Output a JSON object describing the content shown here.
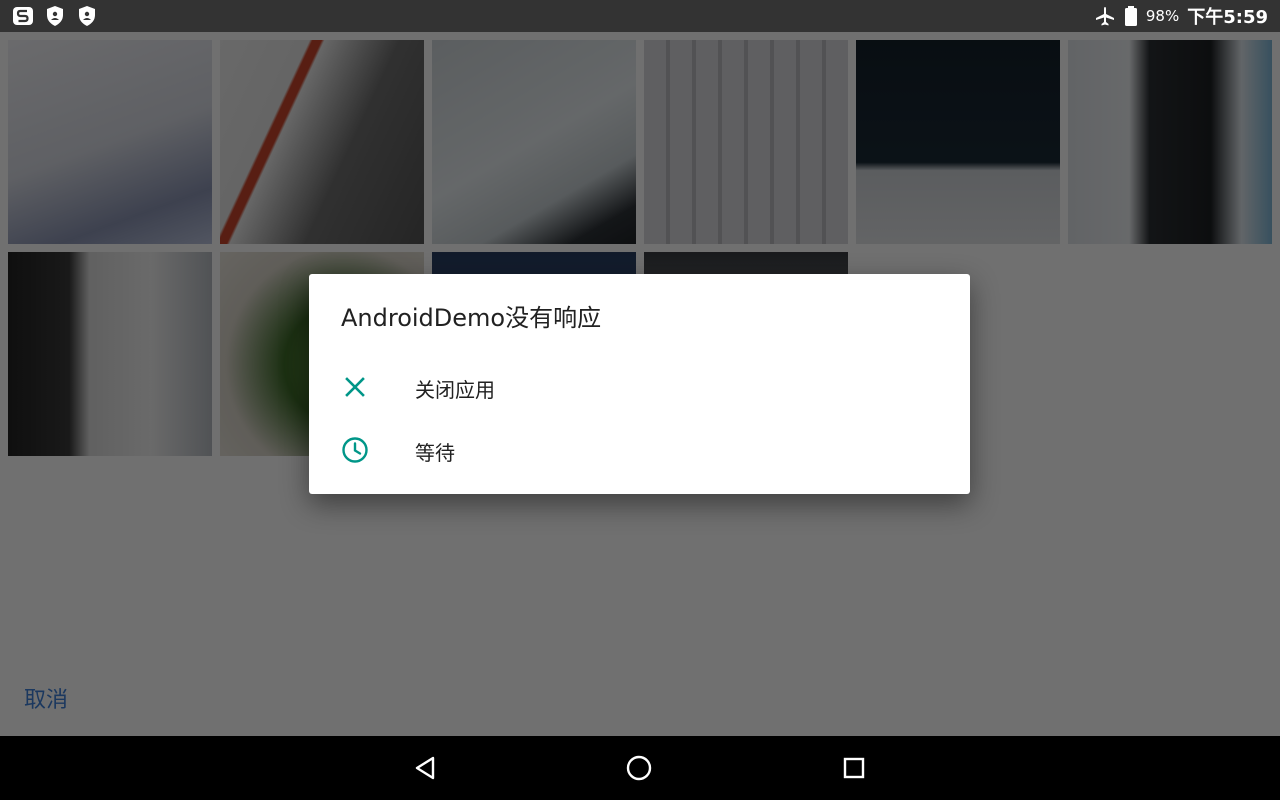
{
  "status_bar": {
    "left_icons": [
      "app-s-icon",
      "shield-icon",
      "shield-icon"
    ],
    "right_icons": [
      "airplane-mode-icon",
      "battery-icon"
    ],
    "battery_percent": "98%",
    "time": "下午5:59"
  },
  "gallery": {
    "thumbnail_count": 10,
    "cancel_label": "取消"
  },
  "dialog": {
    "title": "AndroidDemo没有响应",
    "options": [
      {
        "icon": "close-icon",
        "label": "关闭应用"
      },
      {
        "icon": "clock-icon",
        "label": "等待"
      }
    ],
    "accent_color": "#009688"
  },
  "nav_bar": {
    "buttons": [
      "back-icon",
      "home-icon",
      "recents-icon"
    ]
  }
}
